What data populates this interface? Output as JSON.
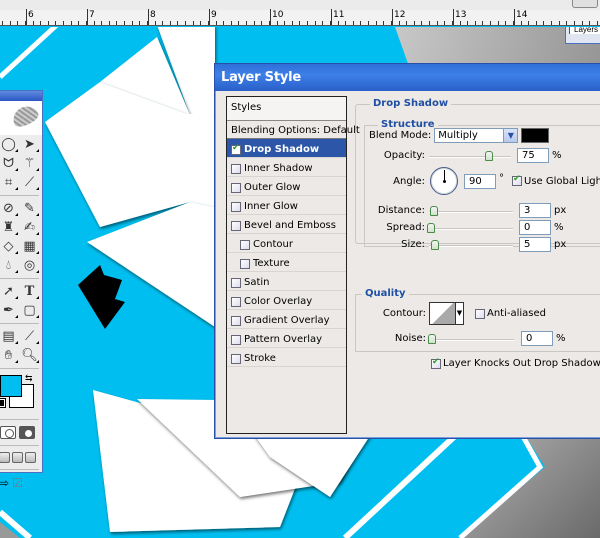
{
  "ruler": {
    "labels": [
      "6",
      "7",
      "8",
      "9",
      "10",
      "11",
      "12",
      "13",
      "14"
    ]
  },
  "toolbox": {
    "tools": [
      [
        "elliptical-marquee",
        "move"
      ],
      [
        "lasso",
        "magic-wand"
      ],
      [
        "crop",
        "slice"
      ],
      [
        "healing-brush",
        "brush"
      ],
      [
        "clone-stamp",
        "history-brush"
      ],
      [
        "eraser",
        "gradient"
      ],
      [
        "blur",
        "dodge"
      ],
      [
        "path-selection",
        "type"
      ],
      [
        "pen",
        "rounded-rectangle"
      ],
      [
        "notes",
        "eyedropper"
      ],
      [
        "hand",
        "zoom"
      ]
    ],
    "foreground_color": "#00bff0",
    "background_color": "#ffffff"
  },
  "layers_panel": {
    "tab_label": "Layers"
  },
  "dialog": {
    "title": "Layer Style",
    "styles_header": "Styles",
    "blending_options": "Blending Options: Default",
    "style_items": [
      {
        "label": "Drop Shadow",
        "checked": true,
        "selected": true,
        "sub": false
      },
      {
        "label": "Inner Shadow",
        "checked": false,
        "selected": false,
        "sub": false
      },
      {
        "label": "Outer Glow",
        "checked": false,
        "selected": false,
        "sub": false
      },
      {
        "label": "Inner Glow",
        "checked": false,
        "selected": false,
        "sub": false
      },
      {
        "label": "Bevel and Emboss",
        "checked": false,
        "selected": false,
        "sub": false
      },
      {
        "label": "Contour",
        "checked": false,
        "selected": false,
        "sub": true
      },
      {
        "label": "Texture",
        "checked": false,
        "selected": false,
        "sub": true
      },
      {
        "label": "Satin",
        "checked": false,
        "selected": false,
        "sub": false
      },
      {
        "label": "Color Overlay",
        "checked": false,
        "selected": false,
        "sub": false
      },
      {
        "label": "Gradient Overlay",
        "checked": false,
        "selected": false,
        "sub": false
      },
      {
        "label": "Pattern Overlay",
        "checked": false,
        "selected": false,
        "sub": false
      },
      {
        "label": "Stroke",
        "checked": false,
        "selected": false,
        "sub": false
      }
    ],
    "drop_shadow": {
      "section_title": "Drop Shadow",
      "structure_title": "Structure",
      "blend_mode_label": "Blend Mode:",
      "blend_mode_value": "Multiply",
      "shadow_color": "#000000",
      "opacity_label": "Opacity:",
      "opacity_value": "75",
      "opacity_unit": "%",
      "opacity_fraction": 0.75,
      "angle_label": "Angle:",
      "angle_value": "90",
      "angle_unit": "°",
      "use_global_light_label": "Use Global Light",
      "use_global_light": true,
      "distance_label": "Distance:",
      "distance_value": "3",
      "distance_unit": "px",
      "distance_fraction": 0.012,
      "spread_label": "Spread:",
      "spread_value": "0",
      "spread_unit": "%",
      "spread_fraction": 0.0,
      "size_label": "Size:",
      "size_value": "5",
      "size_unit": "px",
      "size_fraction": 0.02
    },
    "quality": {
      "title": "Quality",
      "contour_label": "Contour:",
      "anti_aliased_label": "Anti-aliased",
      "anti_aliased": false,
      "noise_label": "Noise:",
      "noise_value": "0",
      "noise_unit": "%",
      "noise_fraction": 0.0
    },
    "knockout_label": "Layer Knocks Out Drop Shadow",
    "knockout": true
  }
}
